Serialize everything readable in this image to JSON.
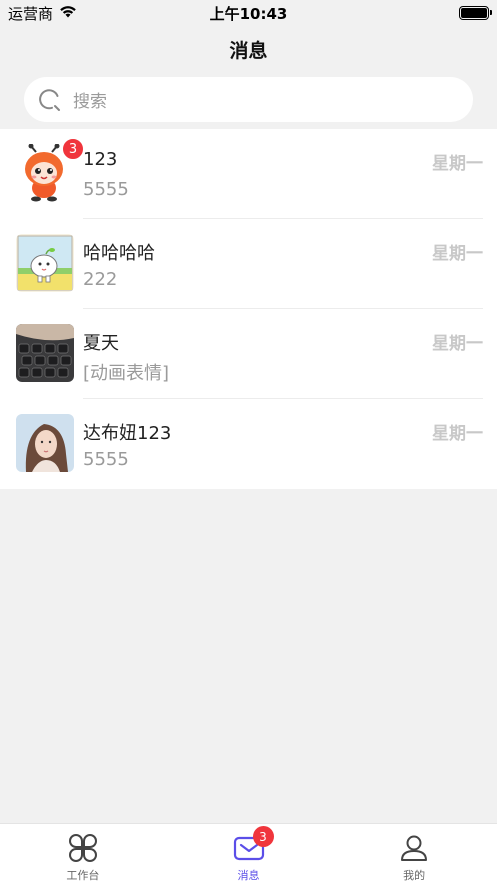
{
  "status_bar": {
    "carrier": "运营商",
    "time": "上午10:43"
  },
  "header": {
    "title": "消息"
  },
  "search": {
    "placeholder": "搜索"
  },
  "conversations": [
    {
      "name": "123",
      "last_message": "5555",
      "time": "星期一",
      "badge": "3",
      "avatar": "ant-cartoon-avatar"
    },
    {
      "name": "哈哈哈哈",
      "last_message": "222",
      "time": "星期一",
      "avatar": "cartoon-field-avatar"
    },
    {
      "name": "夏天",
      "last_message": "[动画表情]",
      "time": "星期一",
      "avatar": "keyboard-photo-avatar"
    },
    {
      "name": "达布妞123",
      "last_message": "5555",
      "time": "星期一",
      "avatar": "portrait-photo-avatar"
    }
  ],
  "tabbar": {
    "tabs": [
      {
        "label": "工作台",
        "icon": "workbench-icon"
      },
      {
        "label": "消息",
        "icon": "mail-icon",
        "badge": "3",
        "active": true
      },
      {
        "label": "我的",
        "icon": "user-icon"
      }
    ]
  },
  "colors": {
    "accent": "#5b4ee8",
    "badge": "#f0353c",
    "background": "#f1f1f1"
  }
}
